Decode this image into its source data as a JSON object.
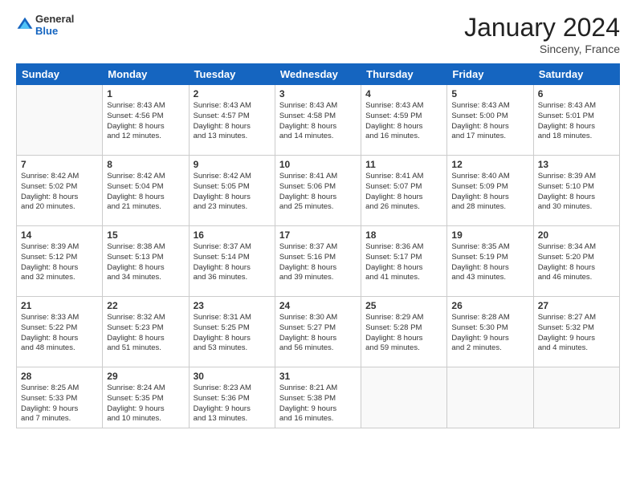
{
  "logo": {
    "general": "General",
    "blue": "Blue"
  },
  "title": "January 2024",
  "location": "Sinceny, France",
  "days": [
    "Sunday",
    "Monday",
    "Tuesday",
    "Wednesday",
    "Thursday",
    "Friday",
    "Saturday"
  ],
  "weeks": [
    [
      {
        "day": "",
        "lines": []
      },
      {
        "day": "1",
        "lines": [
          "Sunrise: 8:43 AM",
          "Sunset: 4:56 PM",
          "Daylight: 8 hours",
          "and 12 minutes."
        ]
      },
      {
        "day": "2",
        "lines": [
          "Sunrise: 8:43 AM",
          "Sunset: 4:57 PM",
          "Daylight: 8 hours",
          "and 13 minutes."
        ]
      },
      {
        "day": "3",
        "lines": [
          "Sunrise: 8:43 AM",
          "Sunset: 4:58 PM",
          "Daylight: 8 hours",
          "and 14 minutes."
        ]
      },
      {
        "day": "4",
        "lines": [
          "Sunrise: 8:43 AM",
          "Sunset: 4:59 PM",
          "Daylight: 8 hours",
          "and 16 minutes."
        ]
      },
      {
        "day": "5",
        "lines": [
          "Sunrise: 8:43 AM",
          "Sunset: 5:00 PM",
          "Daylight: 8 hours",
          "and 17 minutes."
        ]
      },
      {
        "day": "6",
        "lines": [
          "Sunrise: 8:43 AM",
          "Sunset: 5:01 PM",
          "Daylight: 8 hours",
          "and 18 minutes."
        ]
      }
    ],
    [
      {
        "day": "7",
        "lines": [
          "Sunrise: 8:42 AM",
          "Sunset: 5:02 PM",
          "Daylight: 8 hours",
          "and 20 minutes."
        ]
      },
      {
        "day": "8",
        "lines": [
          "Sunrise: 8:42 AM",
          "Sunset: 5:04 PM",
          "Daylight: 8 hours",
          "and 21 minutes."
        ]
      },
      {
        "day": "9",
        "lines": [
          "Sunrise: 8:42 AM",
          "Sunset: 5:05 PM",
          "Daylight: 8 hours",
          "and 23 minutes."
        ]
      },
      {
        "day": "10",
        "lines": [
          "Sunrise: 8:41 AM",
          "Sunset: 5:06 PM",
          "Daylight: 8 hours",
          "and 25 minutes."
        ]
      },
      {
        "day": "11",
        "lines": [
          "Sunrise: 8:41 AM",
          "Sunset: 5:07 PM",
          "Daylight: 8 hours",
          "and 26 minutes."
        ]
      },
      {
        "day": "12",
        "lines": [
          "Sunrise: 8:40 AM",
          "Sunset: 5:09 PM",
          "Daylight: 8 hours",
          "and 28 minutes."
        ]
      },
      {
        "day": "13",
        "lines": [
          "Sunrise: 8:39 AM",
          "Sunset: 5:10 PM",
          "Daylight: 8 hours",
          "and 30 minutes."
        ]
      }
    ],
    [
      {
        "day": "14",
        "lines": [
          "Sunrise: 8:39 AM",
          "Sunset: 5:12 PM",
          "Daylight: 8 hours",
          "and 32 minutes."
        ]
      },
      {
        "day": "15",
        "lines": [
          "Sunrise: 8:38 AM",
          "Sunset: 5:13 PM",
          "Daylight: 8 hours",
          "and 34 minutes."
        ]
      },
      {
        "day": "16",
        "lines": [
          "Sunrise: 8:37 AM",
          "Sunset: 5:14 PM",
          "Daylight: 8 hours",
          "and 36 minutes."
        ]
      },
      {
        "day": "17",
        "lines": [
          "Sunrise: 8:37 AM",
          "Sunset: 5:16 PM",
          "Daylight: 8 hours",
          "and 39 minutes."
        ]
      },
      {
        "day": "18",
        "lines": [
          "Sunrise: 8:36 AM",
          "Sunset: 5:17 PM",
          "Daylight: 8 hours",
          "and 41 minutes."
        ]
      },
      {
        "day": "19",
        "lines": [
          "Sunrise: 8:35 AM",
          "Sunset: 5:19 PM",
          "Daylight: 8 hours",
          "and 43 minutes."
        ]
      },
      {
        "day": "20",
        "lines": [
          "Sunrise: 8:34 AM",
          "Sunset: 5:20 PM",
          "Daylight: 8 hours",
          "and 46 minutes."
        ]
      }
    ],
    [
      {
        "day": "21",
        "lines": [
          "Sunrise: 8:33 AM",
          "Sunset: 5:22 PM",
          "Daylight: 8 hours",
          "and 48 minutes."
        ]
      },
      {
        "day": "22",
        "lines": [
          "Sunrise: 8:32 AM",
          "Sunset: 5:23 PM",
          "Daylight: 8 hours",
          "and 51 minutes."
        ]
      },
      {
        "day": "23",
        "lines": [
          "Sunrise: 8:31 AM",
          "Sunset: 5:25 PM",
          "Daylight: 8 hours",
          "and 53 minutes."
        ]
      },
      {
        "day": "24",
        "lines": [
          "Sunrise: 8:30 AM",
          "Sunset: 5:27 PM",
          "Daylight: 8 hours",
          "and 56 minutes."
        ]
      },
      {
        "day": "25",
        "lines": [
          "Sunrise: 8:29 AM",
          "Sunset: 5:28 PM",
          "Daylight: 8 hours",
          "and 59 minutes."
        ]
      },
      {
        "day": "26",
        "lines": [
          "Sunrise: 8:28 AM",
          "Sunset: 5:30 PM",
          "Daylight: 9 hours",
          "and 2 minutes."
        ]
      },
      {
        "day": "27",
        "lines": [
          "Sunrise: 8:27 AM",
          "Sunset: 5:32 PM",
          "Daylight: 9 hours",
          "and 4 minutes."
        ]
      }
    ],
    [
      {
        "day": "28",
        "lines": [
          "Sunrise: 8:25 AM",
          "Sunset: 5:33 PM",
          "Daylight: 9 hours",
          "and 7 minutes."
        ]
      },
      {
        "day": "29",
        "lines": [
          "Sunrise: 8:24 AM",
          "Sunset: 5:35 PM",
          "Daylight: 9 hours",
          "and 10 minutes."
        ]
      },
      {
        "day": "30",
        "lines": [
          "Sunrise: 8:23 AM",
          "Sunset: 5:36 PM",
          "Daylight: 9 hours",
          "and 13 minutes."
        ]
      },
      {
        "day": "31",
        "lines": [
          "Sunrise: 8:21 AM",
          "Sunset: 5:38 PM",
          "Daylight: 9 hours",
          "and 16 minutes."
        ]
      },
      {
        "day": "",
        "lines": []
      },
      {
        "day": "",
        "lines": []
      },
      {
        "day": "",
        "lines": []
      }
    ]
  ]
}
